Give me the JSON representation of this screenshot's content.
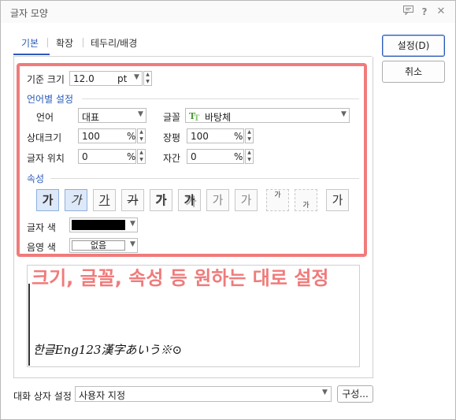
{
  "window": {
    "title": "글자 모양",
    "icons": [
      "comment-icon",
      "help-icon",
      "close-icon"
    ]
  },
  "tabs": [
    {
      "label": "기본",
      "active": true
    },
    {
      "label": "확장",
      "active": false
    },
    {
      "label": "테두리/배경",
      "active": false
    }
  ],
  "buttons": {
    "ok": "설정(D)",
    "cancel": "취소",
    "config": "구성..."
  },
  "base_size": {
    "label": "기준 크기",
    "value": "12.0",
    "unit": "pt"
  },
  "lang_section": "언어별 설정",
  "language": {
    "label": "언어",
    "value": "대표"
  },
  "font": {
    "label": "글꼴",
    "value": "바탕체",
    "icon": "truetype-font-icon"
  },
  "relative_size": {
    "label": "상대크기",
    "value": "100",
    "unit": "%"
  },
  "width_ratio": {
    "label": "장평",
    "value": "100",
    "unit": "%"
  },
  "position": {
    "label": "글자 위치",
    "value": "0",
    "unit": "%"
  },
  "spacing": {
    "label": "자간",
    "value": "0",
    "unit": "%"
  },
  "attr_section": "속성",
  "attributes": [
    {
      "glyph": "가",
      "name": "bold",
      "on": true
    },
    {
      "glyph": "가",
      "name": "italic",
      "on": true
    },
    {
      "glyph": "가",
      "name": "underline",
      "on": false
    },
    {
      "glyph": "가",
      "name": "strikethrough",
      "on": false
    },
    {
      "glyph": "가",
      "name": "outline",
      "on": false
    },
    {
      "glyph": "가",
      "name": "shadow",
      "on": false
    },
    {
      "glyph": "가",
      "name": "emboss",
      "on": false
    },
    {
      "glyph": "가",
      "name": "engrave",
      "on": false
    },
    {
      "glyph": "가",
      "name": "superscript",
      "on": false
    },
    {
      "glyph": "가",
      "name": "subscript",
      "on": false
    },
    {
      "glyph": "가",
      "name": "normal",
      "on": false
    }
  ],
  "text_color": {
    "label": "글자 색",
    "value": "#000000"
  },
  "shade_color": {
    "label": "음영 색",
    "value": "없음"
  },
  "annotation": "크기, 글꼴, 속성 등 원하는 대로 설정",
  "preview_text": "한글Eng123漢字あいう※⊙",
  "footer": {
    "label": "대화 상자 설정",
    "value": "사용자 지정"
  },
  "colors": {
    "accent": "#2b5bb8",
    "highlight": "#f07b7b"
  }
}
